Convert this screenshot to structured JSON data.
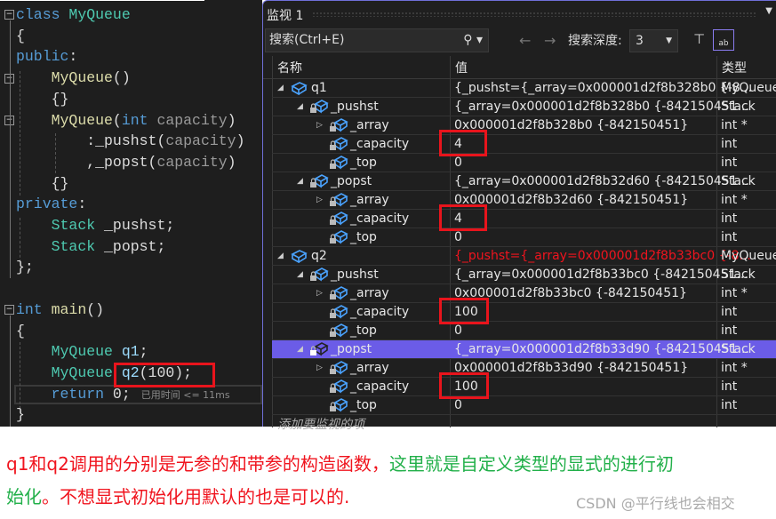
{
  "colors": {
    "keyword": "#569cd6",
    "type": "#4ec9b0",
    "func": "#dcdcaa",
    "param": "#9a9a9a",
    "plain": "#dcdcdc",
    "var": "#9cdcfe",
    "string_red": "#f0141e",
    "highlight_row": "#6b5ce7",
    "annotation_box": "#e8141c",
    "caption_red": "#f0141e",
    "caption_green": "#22b04a"
  },
  "code": {
    "lines": [
      [
        {
          "t": "class ",
          "c": "keyword"
        },
        {
          "t": "MyQueue",
          "c": "type"
        }
      ],
      [
        {
          "t": "{",
          "c": "plain"
        }
      ],
      [
        {
          "t": "public",
          "c": "keyword"
        },
        {
          "t": ":",
          "c": "plain"
        }
      ],
      [
        {
          "t": "    ",
          "c": "plain"
        },
        {
          "t": "MyQueue",
          "c": "func"
        },
        {
          "t": "()",
          "c": "plain"
        }
      ],
      [
        {
          "t": "    ",
          "c": "plain"
        },
        {
          "t": "{}",
          "c": "plain"
        }
      ],
      [
        {
          "t": "    ",
          "c": "plain"
        },
        {
          "t": "MyQueue",
          "c": "func"
        },
        {
          "t": "(",
          "c": "plain"
        },
        {
          "t": "int ",
          "c": "keyword"
        },
        {
          "t": "capacity",
          "c": "param"
        },
        {
          "t": ")",
          "c": "plain"
        }
      ],
      [
        {
          "t": "        :",
          "c": "plain"
        },
        {
          "t": "_pushst",
          "c": "plain"
        },
        {
          "t": "(",
          "c": "plain"
        },
        {
          "t": "capacity",
          "c": "param"
        },
        {
          "t": ")",
          "c": "plain"
        }
      ],
      [
        {
          "t": "        ,",
          "c": "plain"
        },
        {
          "t": "_popst",
          "c": "plain"
        },
        {
          "t": "(",
          "c": "plain"
        },
        {
          "t": "capacity",
          "c": "param"
        },
        {
          "t": ")",
          "c": "plain"
        }
      ],
      [
        {
          "t": "    ",
          "c": "plain"
        },
        {
          "t": "{}",
          "c": "plain"
        }
      ],
      [
        {
          "t": "private",
          "c": "keyword"
        },
        {
          "t": ":",
          "c": "plain"
        }
      ],
      [
        {
          "t": "    ",
          "c": "plain"
        },
        {
          "t": "Stack ",
          "c": "type"
        },
        {
          "t": "_pushst;",
          "c": "plain"
        }
      ],
      [
        {
          "t": "    ",
          "c": "plain"
        },
        {
          "t": "Stack ",
          "c": "type"
        },
        {
          "t": "_popst;",
          "c": "plain"
        }
      ],
      [
        {
          "t": "};",
          "c": "plain"
        }
      ],
      [],
      [
        {
          "t": "int ",
          "c": "keyword"
        },
        {
          "t": "main",
          "c": "func"
        },
        {
          "t": "()",
          "c": "plain"
        }
      ],
      [
        {
          "t": "{",
          "c": "plain"
        }
      ],
      [
        {
          "t": "    ",
          "c": "plain"
        },
        {
          "t": "MyQueue ",
          "c": "type"
        },
        {
          "t": "q1",
          "c": "var"
        },
        {
          "t": ";",
          "c": "plain"
        }
      ],
      [
        {
          "t": "    ",
          "c": "plain"
        },
        {
          "t": "MyQueue ",
          "c": "type"
        },
        {
          "t": "q2",
          "c": "var"
        },
        {
          "t": "(100);",
          "c": "plain"
        }
      ],
      [
        {
          "t": "    ",
          "c": "plain"
        },
        {
          "t": "return ",
          "c": "keyword"
        },
        {
          "t": "0;",
          "c": "plain"
        }
      ],
      [
        {
          "t": "}",
          "c": "plain"
        }
      ]
    ],
    "elapsed": "已用时间 <= 11ms"
  },
  "watch": {
    "title": "监视 1",
    "search_placeholder": "搜索(Ctrl+E)",
    "depth_label": "搜索深度:",
    "depth_value": "3",
    "columns": {
      "name": "名称",
      "value": "值",
      "type": "类型"
    },
    "rows": [
      {
        "name": "q1",
        "value": "{_pushst={_array=0x000001d2f8b328b0 {-8...",
        "type": "MyQueue",
        "level": 0,
        "exp": "open",
        "icon": "object"
      },
      {
        "name": "_pushst",
        "value": "{_array=0x000001d2f8b328b0 {-842150451...",
        "type": "Stack",
        "level": 1,
        "exp": "open",
        "icon": "private-field"
      },
      {
        "name": "_array",
        "value": "0x000001d2f8b328b0 {-842150451}",
        "type": "int *",
        "level": 2,
        "exp": "closed",
        "icon": "private-field"
      },
      {
        "name": "_capacity",
        "value": "4",
        "type": "int",
        "level": 2,
        "exp": "none",
        "icon": "private-field",
        "boxed": true
      },
      {
        "name": "_top",
        "value": "0",
        "type": "int",
        "level": 2,
        "exp": "none",
        "icon": "private-field"
      },
      {
        "name": "_popst",
        "value": "{_array=0x000001d2f8b32d60 {-842150451...",
        "type": "Stack",
        "level": 1,
        "exp": "open",
        "icon": "private-field"
      },
      {
        "name": "_array",
        "value": "0x000001d2f8b32d60 {-842150451}",
        "type": "int *",
        "level": 2,
        "exp": "closed",
        "icon": "private-field"
      },
      {
        "name": "_capacity",
        "value": "4",
        "type": "int",
        "level": 2,
        "exp": "none",
        "icon": "private-field",
        "boxed": true
      },
      {
        "name": "_top",
        "value": "0",
        "type": "int",
        "level": 2,
        "exp": "none",
        "icon": "private-field"
      },
      {
        "name": "q2",
        "value": "{_pushst={_array=0x000001d2f8b33bc0 {-8...",
        "type": "MyQueue",
        "level": 0,
        "exp": "open",
        "icon": "object",
        "changed": true
      },
      {
        "name": "_pushst",
        "value": "{_array=0x000001d2f8b33bc0 {-842150451...",
        "type": "Stack",
        "level": 1,
        "exp": "open",
        "icon": "private-field"
      },
      {
        "name": "_array",
        "value": "0x000001d2f8b33bc0 {-842150451}",
        "type": "int *",
        "level": 2,
        "exp": "closed",
        "icon": "private-field"
      },
      {
        "name": "_capacity",
        "value": "100",
        "type": "int",
        "level": 2,
        "exp": "none",
        "icon": "private-field",
        "boxed": true
      },
      {
        "name": "_top",
        "value": "0",
        "type": "int",
        "level": 2,
        "exp": "none",
        "icon": "private-field"
      },
      {
        "name": "_popst",
        "value": "{_array=0x000001d2f8b33d90 {-842150451...",
        "type": "Stack",
        "level": 1,
        "exp": "open",
        "icon": "private-field",
        "selected": true
      },
      {
        "name": "_array",
        "value": "0x000001d2f8b33d90 {-842150451}",
        "type": "int *",
        "level": 2,
        "exp": "closed",
        "icon": "private-field"
      },
      {
        "name": "_capacity",
        "value": "100",
        "type": "int",
        "level": 2,
        "exp": "none",
        "icon": "private-field",
        "boxed": true
      },
      {
        "name": "_top",
        "value": "0",
        "type": "int",
        "level": 2,
        "exp": "none",
        "icon": "private-field"
      }
    ],
    "add_item": "添加要监视的项"
  },
  "caption": {
    "line1_red": "q1和q2调用的分别是无参的和带参的构造函数，",
    "line1_green": "这里就是自定义类型的显式的进行初",
    "line2_green": "始化",
    "line2_red": "。不想显式初始化用默认的也是可以的."
  },
  "watermark": "CSDN @平行线也会相交"
}
